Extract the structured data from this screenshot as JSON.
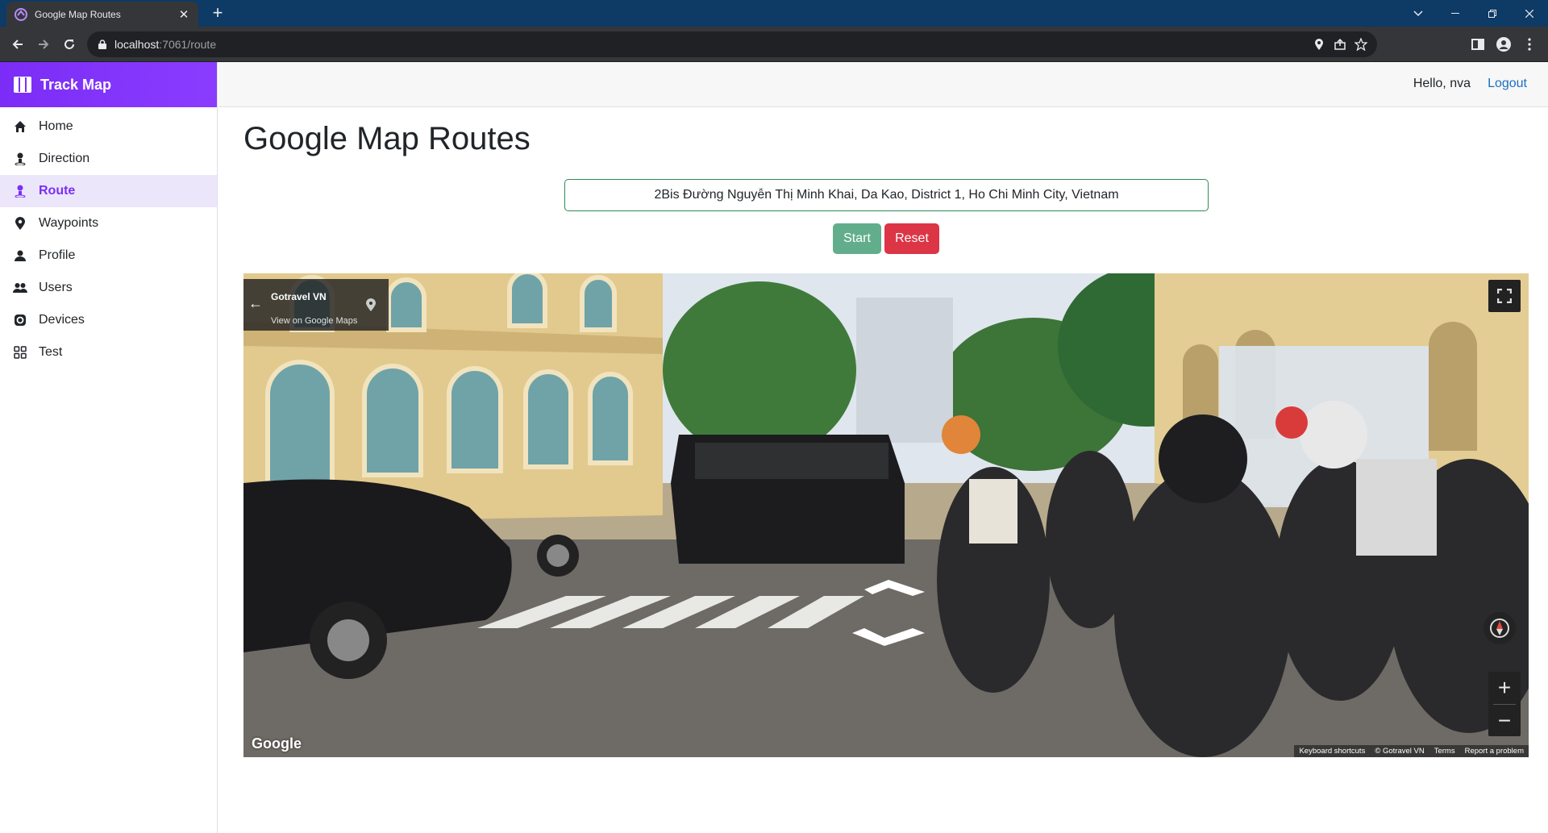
{
  "browser": {
    "tab_title": "Google Map Routes",
    "url_host": "localhost",
    "url_path": ":7061/route"
  },
  "brand": {
    "name": "Track Map"
  },
  "sidebar": {
    "items": [
      {
        "label": "Home",
        "icon": "home-icon"
      },
      {
        "label": "Direction",
        "icon": "person-pin-icon"
      },
      {
        "label": "Route",
        "icon": "person-route-icon",
        "active": true
      },
      {
        "label": "Waypoints",
        "icon": "map-pin-icon"
      },
      {
        "label": "Profile",
        "icon": "person-icon"
      },
      {
        "label": "Users",
        "icon": "users-icon"
      },
      {
        "label": "Devices",
        "icon": "device-icon"
      },
      {
        "label": "Test",
        "icon": "grid-icon"
      }
    ]
  },
  "header": {
    "greeting": "Hello, nva",
    "logout_label": "Logout"
  },
  "main": {
    "title": "Google Map Routes",
    "address_value": "2Bis Đường Nguyễn Thị Minh Khai, Da Kao, District 1, Ho Chi Minh City, Vietnam",
    "start_label": "Start",
    "reset_label": "Reset"
  },
  "streetview": {
    "place_name": "Gotravel VN",
    "view_link": "View on Google Maps",
    "google_logo": "Google",
    "attribution": [
      "Keyboard shortcuts",
      "© Gotravel VN",
      "Terms",
      "Report a problem"
    ],
    "zoom_in": "+",
    "zoom_out": "−"
  },
  "colors": {
    "brand": "#7b2ff7",
    "active_bg": "#ece6fb",
    "start_button": "#62ae8c",
    "reset_button": "#dc3545",
    "input_border": "#2e8b57",
    "link": "#1b6ec2"
  }
}
